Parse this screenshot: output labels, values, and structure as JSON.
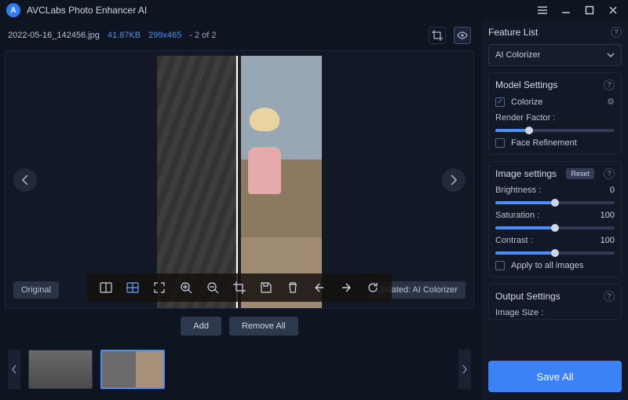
{
  "titlebar": {
    "title": "AVCLabs Photo Enhancer AI"
  },
  "fileinfo": {
    "filename": "2022-05-16_142456.jpg",
    "filesize": "41.87KB",
    "dimensions": "299x465",
    "counter": "- 2 of 2"
  },
  "badges": {
    "original": "Original",
    "updated": "Updated: AI Colorizer"
  },
  "midbar": {
    "add": "Add",
    "remove_all": "Remove All"
  },
  "side": {
    "feature_list": {
      "title": "Feature List",
      "selected": "AI Colorizer"
    },
    "model": {
      "title": "Model Settings",
      "colorize_label": "Colorize",
      "colorize_checked": true,
      "render_factor_label": "Render Factor :",
      "render_factor_pct": 28,
      "face_refine_label": "Face Refinement",
      "face_refine_checked": false
    },
    "image": {
      "title": "Image settings",
      "reset": "Reset",
      "brightness_label": "Brightness :",
      "brightness_value": "0",
      "brightness_pct": 50,
      "saturation_label": "Saturation :",
      "saturation_value": "100",
      "saturation_pct": 50,
      "contrast_label": "Contrast :",
      "contrast_value": "100",
      "contrast_pct": 50,
      "apply_all_label": "Apply to all images",
      "apply_all_checked": false
    },
    "output": {
      "title": "Output Settings",
      "image_size_label": "Image Size :"
    },
    "save": "Save All"
  }
}
